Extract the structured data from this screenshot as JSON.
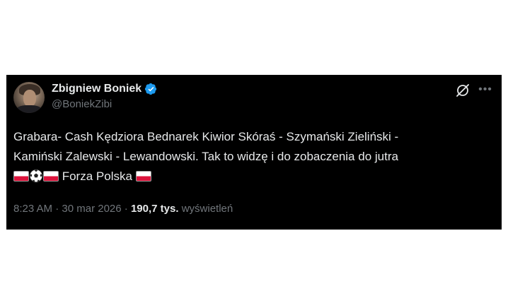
{
  "author": {
    "display_name": "Zbigniew Boniek",
    "handle": "@BoniekZibi",
    "verified": true
  },
  "tweet": {
    "text_line_1": "Grabara- Cash Kędziora Bednarek Kiwior Skóraś - Szymański Zieliński -",
    "text_line_2": "Kamiński Zalewski - Lewandowski. Tak to widzę i do zobaczenia do jutra",
    "text_line_3_suffix": " Forza Polska ",
    "emojis": [
      "flag-poland",
      "soccer-ball",
      "flag-poland",
      "flag-poland"
    ]
  },
  "meta": {
    "time": "8:23 AM",
    "separator": "·",
    "date": "30 mar 2026",
    "views_count": "190,7 tys.",
    "views_label": "wyświetleń"
  },
  "icons": {
    "verified": "verified-badge-icon",
    "grok": "grok-icon",
    "more": "more-icon"
  },
  "colors": {
    "background": "#000000",
    "text": "#e7e9ea",
    "secondary_text": "#71767b",
    "verified_blue": "#1d9bf0",
    "flag_red": "#dc143c"
  }
}
